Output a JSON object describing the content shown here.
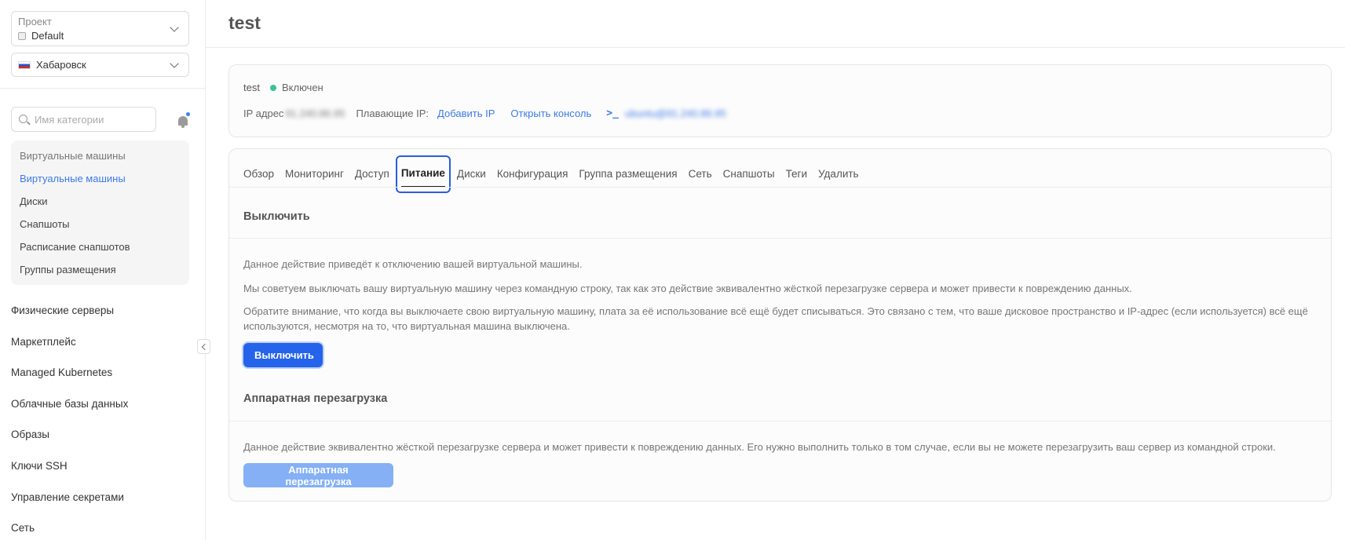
{
  "sidebar": {
    "project": {
      "label": "Проект",
      "value": "Default"
    },
    "region": {
      "value": "Хабаровск"
    },
    "search": {
      "placeholder": "Имя категории"
    },
    "subnav": [
      "Виртуальные машины",
      "Виртуальные машины",
      "Диски",
      "Снапшоты",
      "Расписание снапшотов",
      "Группы размещения"
    ],
    "nav": [
      "Физические серверы",
      "Маркетплейс",
      "Managed Kubernetes",
      "Облачные базы данных",
      "Образы",
      "Ключи SSH",
      "Управление секретами",
      "Сеть"
    ]
  },
  "page": {
    "title": "test"
  },
  "vm": {
    "name": "test",
    "status": "Включен",
    "ip_label": "IP адрес",
    "ip_value": "91.240.86.95",
    "floating_ip_label": "Плавающие IP:",
    "add_ip": "Добавить IP",
    "open_console": "Открыть консоль",
    "terminal_icon": ">_",
    "ssh_value": "ubuntu@91.240.86.95"
  },
  "tabs": [
    "Обзор",
    "Мониторинг",
    "Доступ",
    "Питание",
    "Диски",
    "Конфигурация",
    "Группа размещения",
    "Сеть",
    "Снапшоты",
    "Теги",
    "Удалить"
  ],
  "power": {
    "shutdown": {
      "title": "Выключить",
      "p1": "Данное действие приведёт к отключению вашей виртуальной машины.",
      "p2": "Мы советуем выключать вашу виртуальную машину через командную строку, так как это действие эквивалентно жёсткой перезагрузке сервера и может привести к повреждению данных.",
      "p3": "Обратите внимание, что когда вы выключаете свою виртуальную машину, плата за её использование всё ещё будет списываться. Это связано с тем, что ваше дисковое пространство и IP-адрес (если используется) всё ещё используются, несмотря на то, что виртуальная машина выключена.",
      "button": "Выключить"
    },
    "hard_reset": {
      "title": "Аппаратная перезагрузка",
      "p1": "Данное действие эквивалентно жёсткой перезагрузке сервера и может привести к повреждению данных. Его нужно выполнить только в том случае, если вы не можете перезагрузить ваш сервер из командной строки.",
      "button": "Аппаратная перезагрузка"
    }
  },
  "colors": {
    "accent": "#2563eb",
    "link": "#3d7be5",
    "status_on": "#3cc28f"
  }
}
